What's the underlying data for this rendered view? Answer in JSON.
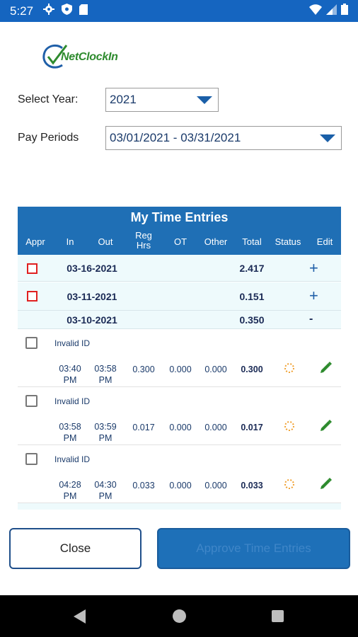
{
  "status_bar": {
    "time": "5:27",
    "icons": [
      "gear-icon",
      "shield-icon",
      "sd-card-icon",
      "wifi-icon",
      "cellular-icon",
      "battery-icon"
    ]
  },
  "logo": {
    "text": "NetClockIn"
  },
  "form": {
    "year_label": "Select Year:",
    "year_value": "2021",
    "pay_period_label": "Pay Periods",
    "pay_period_value": "03/01/2021 - 03/31/2021"
  },
  "table": {
    "title": "My Time Entries",
    "columns": {
      "appr": "Appr",
      "in": "In",
      "out": "Out",
      "reg_line1": "Reg",
      "reg_line2": "Hrs",
      "ot": "OT",
      "other": "Other",
      "total": "Total",
      "status": "Status",
      "edit": "Edit"
    },
    "date_rows": [
      {
        "date": "03-16-2021",
        "total": "2.417",
        "toggle": "+"
      },
      {
        "date": "03-11-2021",
        "total": "0.151",
        "toggle": "+"
      },
      {
        "date": "03-10-2021",
        "total": "0.350",
        "toggle": "-"
      }
    ],
    "entries": [
      {
        "id_text": "Invalid ID",
        "in_time": "03:40",
        "in_ampm": "PM",
        "out_time": "03:58",
        "out_ampm": "PM",
        "reg": "0.300",
        "ot": "0.000",
        "other": "0.000",
        "total": "0.300"
      },
      {
        "id_text": "Invalid ID",
        "in_time": "03:58",
        "in_ampm": "PM",
        "out_time": "03:59",
        "out_ampm": "PM",
        "reg": "0.017",
        "ot": "0.000",
        "other": "0.000",
        "total": "0.017"
      },
      {
        "id_text": "Invalid ID",
        "in_time": "04:28",
        "in_ampm": "PM",
        "out_time": "04:30",
        "out_ampm": "PM",
        "reg": "0.033",
        "ot": "0.000",
        "other": "0.000",
        "total": "0.033"
      }
    ]
  },
  "buttons": {
    "close": "Close",
    "approve": "Approve Time Entries"
  },
  "colors": {
    "status_bar": "#1565c0",
    "table_header": "#1f6fb5",
    "approve_button": "#1e70b8",
    "checkbox_red": "#e02020",
    "logo_green": "#2e8b2e",
    "edit_green": "#2e8b2e",
    "status_orange": "#f0a030"
  }
}
